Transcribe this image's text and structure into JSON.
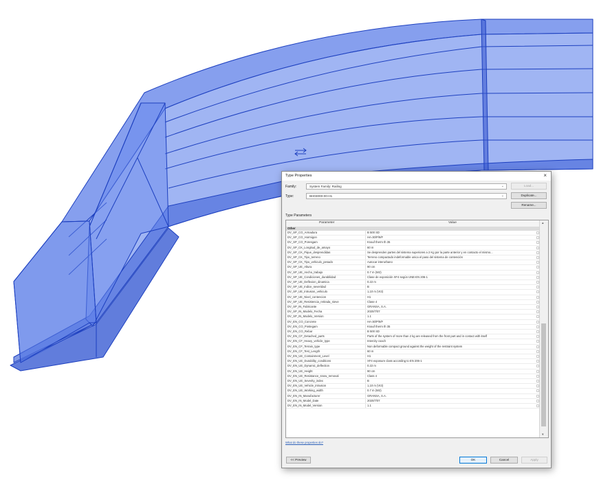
{
  "dialog": {
    "title": "Type Properties",
    "family_label": "Family:",
    "family_value": "System Family: Railing",
    "type_label": "Type:",
    "type_value": "BH03000-00-H1",
    "load_button": "Load...",
    "duplicate_button": "Duplicate...",
    "rename_button": "Rename...",
    "section_label": "Type Parameters",
    "col_parameter": "Parameter",
    "col_value": "Value",
    "group_label": "Other",
    "rows": [
      {
        "p": "DV_SP_CO_Armadura",
        "v": "B 500 SD"
      },
      {
        "p": "DV_SP_CO_Hormigon",
        "v": "HA-30/P/9/F"
      },
      {
        "p": "DV_SP_CO_Poresgam",
        "v": "Knauf therm th 35"
      },
      {
        "p": "DV_SP_CK_Longitud_de_amayo",
        "v": "60 m"
      },
      {
        "p": "DV_SP_CK_Pique_desprendidas",
        "v": "Se desprenden partes del sistema superiores a 2 Kg por la parte anterior y en contacto el mismo..."
      },
      {
        "p": "DV_SP_CK_Tipo_terreno",
        "v": "Terreno compactado indeformable unica el paso del sistema de contención"
      },
      {
        "p": "DV_SP_CK_Tipo_vehiculo_pesado",
        "v": "Autocar interurbano"
      },
      {
        "p": "DV_SP_UE_Altura",
        "v": "90 cm"
      },
      {
        "p": "DV_SP_UE_Ancho_trabajo",
        "v": "0.7 m (W2)"
      },
      {
        "p": "DV_SP_UE_Condiciones_durabilidad",
        "v": "Clase de exposición XF4 según UNE-EN 206-1"
      },
      {
        "p": "DV_SP_UE_Deflexion_dinamica",
        "v": "0.22 m"
      },
      {
        "p": "DV_SP_UE_Indice_severidad",
        "v": "B"
      },
      {
        "p": "DV_SP_UE_Intrusion_vehiculo",
        "v": "1,10 m (VI3)"
      },
      {
        "p": "DV_SP_UE_Nivel_contencion",
        "v": "H1"
      },
      {
        "p": "DV_SP_UE_Resistencia_retirada_nieve",
        "v": "Clase 4"
      },
      {
        "p": "DV_SP_IN_Fabricante",
        "v": "GRANSA, S.A."
      },
      {
        "p": "DV_SP_IN_Modelo_Fecha",
        "v": "2020/7/07"
      },
      {
        "p": "DV_SP_IN_Modelo_Version",
        "v": "1.1"
      },
      {
        "p": "DV_EN_CO_Concrete",
        "v": "HA-30/P/9/F"
      },
      {
        "p": "DV_EN_CO_Postegam",
        "v": "Knauf therm th 35"
      },
      {
        "p": "DV_EN_CO_Rebar",
        "v": "B 500 SD"
      },
      {
        "p": "DV_EN_CF_Detached_parts",
        "v": "Parts of the system of more than 2 kg are released from the front part and in contact with itself"
      },
      {
        "p": "DV_EN_CF_Heavy_vehicle_type",
        "v": "Intercity coach"
      },
      {
        "p": "DV_EN_CF_Terrain_type",
        "v": "Non deformable compact ground against the weight of the restraint system"
      },
      {
        "p": "DV_EN_CF_Test_Length",
        "v": "60 m"
      },
      {
        "p": "DV_EN_UE_Containment_Level",
        "v": "H1"
      },
      {
        "p": "DV_EN_UE_Durability_conditions",
        "v": "XF4 exposure class according to EN 206-1"
      },
      {
        "p": "DV_EN_UE_Dynamic_deflection",
        "v": "0.22 m"
      },
      {
        "p": "DV_EN_UE_Height",
        "v": "90 cm"
      },
      {
        "p": "DV_EN_UE_Resistance_snow_removal",
        "v": "Class 4"
      },
      {
        "p": "DV_EN_UE_Severity_index",
        "v": "B"
      },
      {
        "p": "DV_EN_UE_Vehicle_intrusion",
        "v": "1,10 m (VI3)"
      },
      {
        "p": "DV_EN_UE_Working_width",
        "v": "0.7 m (W2)"
      },
      {
        "p": "DV_EN_IN_Manufacturer",
        "v": "GRANSA, S.A."
      },
      {
        "p": "DV_EN_IN_Model_Date",
        "v": "2020/7/07"
      },
      {
        "p": "DV_EN_IN_Model_Version",
        "v": "1.1"
      }
    ],
    "help_link": "What do these properties do?",
    "preview_button": "<< Preview",
    "ok_button": "OK",
    "cancel_button": "Cancel",
    "apply_button": "Apply"
  },
  "colors": {
    "model_fill": "#6f8ff0",
    "model_edge": "#1c3fbf",
    "dialog_bg": "#f0f0f0"
  }
}
